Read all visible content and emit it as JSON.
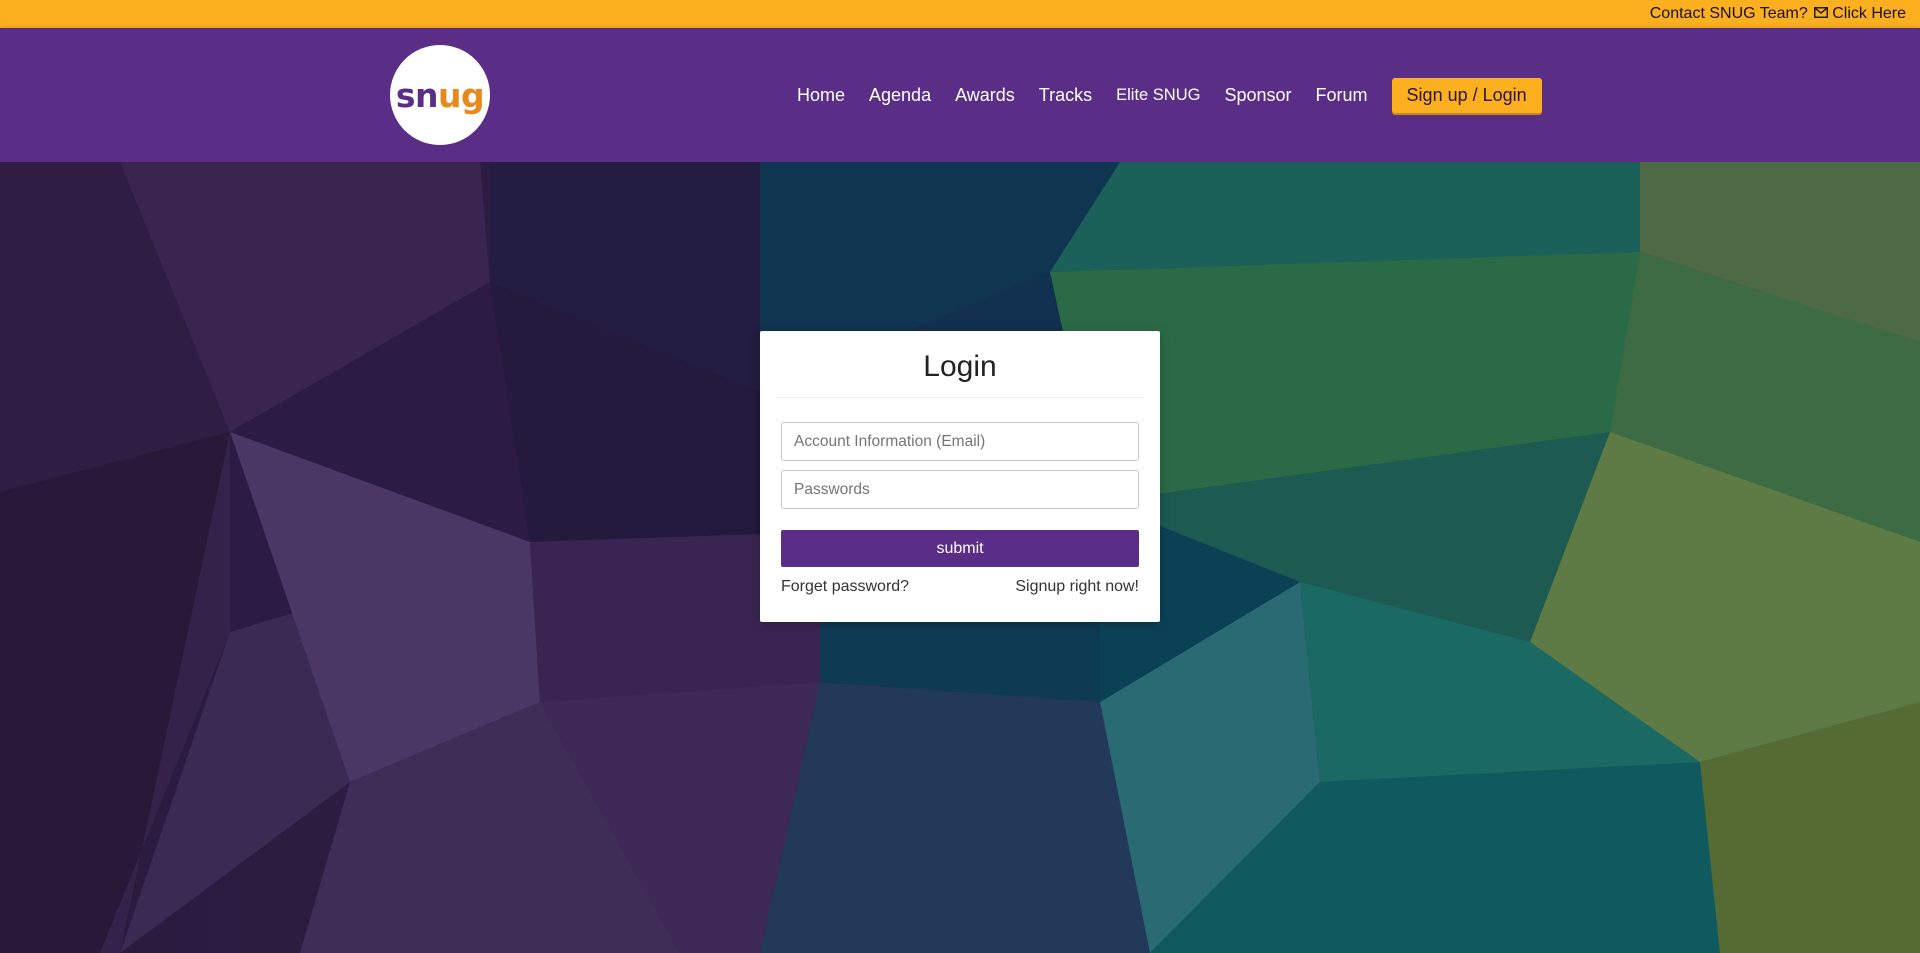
{
  "topbar": {
    "contact_text": "Contact SNUG Team?",
    "click_label": "Click Here",
    "icon": "mail-icon",
    "background": "#fcaf1f"
  },
  "header": {
    "logo": {
      "part1": "sn",
      "part2": "ug",
      "alt": "snug"
    },
    "background": "#5a2e86",
    "nav": [
      {
        "label": "Home"
      },
      {
        "label": "Agenda"
      },
      {
        "label": "Awards"
      },
      {
        "label": "Tracks"
      },
      {
        "label": "Elite SNUG"
      },
      {
        "label": "Sponsor"
      },
      {
        "label": "Forum"
      }
    ],
    "cta_label": "Sign up / Login"
  },
  "login": {
    "title": "Login",
    "email_placeholder": "Account Information (Email)",
    "email_value": "",
    "password_placeholder": "Passwords",
    "password_value": "",
    "submit_label": "submit",
    "forgot_label": "Forget password?",
    "signup_label": "Signup right now!"
  },
  "colors": {
    "accent": "#fcaf1f",
    "brand": "#5a2e86"
  }
}
